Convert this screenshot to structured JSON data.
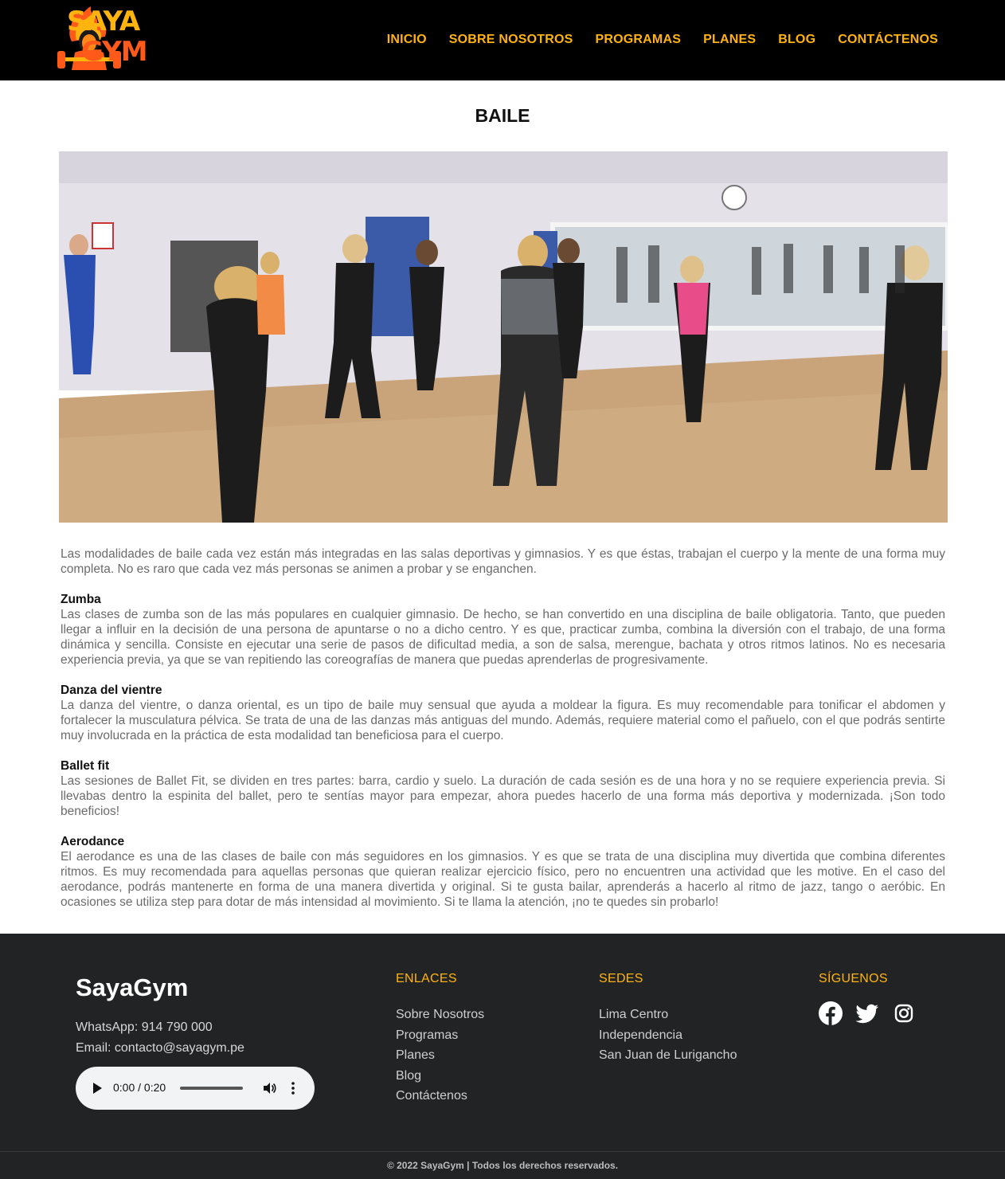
{
  "header": {
    "logo_line1": "SAYA",
    "logo_line2": "GYM",
    "nav": [
      "INICIO",
      "SOBRE NOSOTROS",
      "PROGRAMAS",
      "PLANES",
      "BLOG",
      "CONTÁCTENOS"
    ]
  },
  "page": {
    "title": "BAILE",
    "intro": "Las modalidades de baile cada vez están más integradas en las salas deportivas y gimnasios. Y es que éstas, trabajan el cuerpo y la mente de una forma muy completa. No es raro que cada vez más personas se animen a probar y se enganchen.",
    "sections": [
      {
        "heading": "Zumba",
        "text": "Las clases de zumba son de las más populares en cualquier gimnasio. De hecho, se han convertido en una disciplina de baile obligatoria. Tanto, que pueden llegar a influir en la decisión de una persona de apuntarse o no a dicho centro. Y es que, practicar zumba, combina la diversión con el trabajo, de una forma dinámica y sencilla. Consiste en ejecutar una serie de pasos de dificultad media, a son de salsa, merengue, bachata y otros ritmos latinos. No es necesaria experiencia previa, ya que se van repitiendo las coreografías de manera que puedas aprenderlas de progresivamente."
      },
      {
        "heading": "Danza del vientre",
        "text": "La danza del vientre, o danza oriental, es un tipo de baile muy sensual que ayuda a moldear la figura. Es muy recomendable para tonificar el abdomen y fortalecer la musculatura pélvica. Se trata de una de las danzas más antiguas del mundo. Además, requiere material como el pañuelo, con el que podrás sentirte muy involucrada en la práctica de esta modalidad tan beneficiosa para el cuerpo."
      },
      {
        "heading": "Ballet fit",
        "text": "Las sesiones de Ballet Fit, se dividen en tres partes: barra, cardio y suelo. La duración de cada sesión es de una hora y no se requiere experiencia previa. Si llevabas dentro la espinita del ballet, pero te sentías mayor para empezar, ahora puedes hacerlo de una forma más deportiva y modernizada. ¡Son todo beneficios!"
      },
      {
        "heading": "Aerodance",
        "text": "El aerodance es una de las clases de baile con más seguidores en los gimnasios. Y es que se trata de una disciplina muy divertida que combina diferentes ritmos. Es muy recomendada para aquellas personas que quieran realizar ejercicio físico, pero no encuentren una actividad que les motive. En el caso del aerodance, podrás mantenerte en forma de una manera divertida y original. Si te gusta bailar, aprenderás a hacerlo al ritmo de jazz, tango o aeróbic. En ocasiones se utiliza step para dotar de más intensidad al movimiento. Si te llama la atención, ¡no te quedes sin probarlo!"
      }
    ]
  },
  "footer": {
    "brand": "SayaGym",
    "whatsapp": "WhatsApp: 914 790 000",
    "email": "Email: contacto@sayagym.pe",
    "audio_time": "0:00 / 0:20",
    "links_title": "ENLACES",
    "links": [
      "Sobre Nosotros",
      "Programas",
      "Planes",
      "Blog",
      "Contáctenos"
    ],
    "sedes_title": "SEDES",
    "sedes": [
      "Lima Centro",
      "Independencia",
      "San Juan de Lurigancho"
    ],
    "social_title": "SÍGUENOS",
    "social_icons": [
      "facebook-icon",
      "twitter-icon",
      "instagram-icon"
    ],
    "copyright": "© 2022 SayaGym | Todos los derechos reservados."
  },
  "colors": {
    "accent": "#ffb30f",
    "header_bg": "#000000",
    "footer_bg": "#222325"
  }
}
